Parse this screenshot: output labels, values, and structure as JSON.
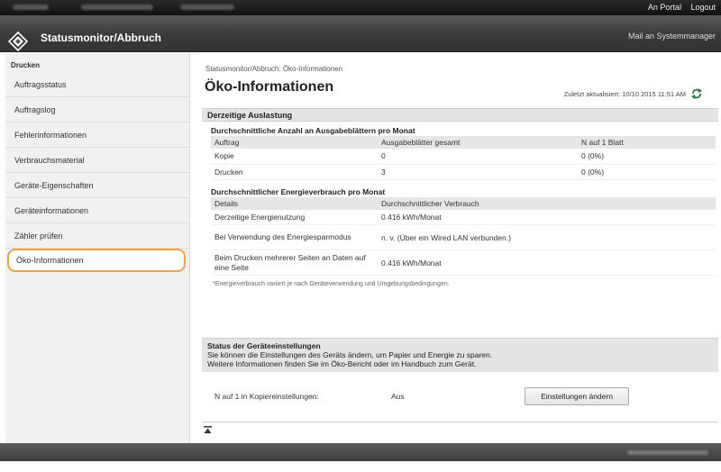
{
  "topbar": {
    "portal_link": "An Portal",
    "logout_link": "Logout"
  },
  "header": {
    "app_title": "Statusmonitor/Abbruch",
    "mail_link": "Mail an Systemmanager"
  },
  "sidebar": {
    "section_label": "Drucken",
    "items": [
      {
        "label": "Auftragsstatus"
      },
      {
        "label": "Auftragslog"
      },
      {
        "label": "Fehlerinformationen"
      },
      {
        "label": "Verbrauchsmaterial"
      },
      {
        "label": "Geräte-Eigenschaften"
      },
      {
        "label": "Geräteinformationen"
      },
      {
        "label": "Zähler prüfen"
      },
      {
        "label": "Öko-Informationen"
      }
    ],
    "active_index": 7
  },
  "main": {
    "breadcrumb": "Statusmonitor/Abbruch: Öko-Informationen",
    "title": "Öko-Informationen",
    "last_updated": "Zuletzt aktualisiert: 10/10 2015 11:51 AM",
    "usage_panel": {
      "header": "Derzeitige Auslastung",
      "pages_title": "Durchschnittliche Anzahl an Ausgabeblättern pro Monat",
      "pages_columns": [
        "Auftrag",
        "Ausgabeblätter gesamt",
        "N auf 1 Blatt"
      ],
      "pages_rows": [
        [
          "Kopie",
          "0",
          "0 (0%)"
        ],
        [
          "Drucken",
          "3",
          "0 (0%)"
        ]
      ],
      "energy_title": "Durchschnittlicher Energieverbrauch pro Monat",
      "energy_columns": [
        "Details",
        "Durchschnittlicher Verbrauch"
      ],
      "energy_rows": [
        [
          "Derzeitige Energienutzung",
          "0.416  kWh/Monat"
        ],
        [
          "Bei Verwendung des Energiesparmodus",
          "n. v. (Über ein Wired LAN verbunden.)"
        ],
        [
          "Beim Drucken mehrerer Seiten an Daten auf eine Seite",
          "0.416  kWh/Monat"
        ]
      ],
      "note": "*Energieverbrauch variiert je nach Geräteverwendung und Umgebungsbedingungen."
    },
    "status_panel": {
      "header": "Status der Geräteeinstellungen",
      "line1": "Sie können die Einstellungen des Geräts ändern, um Papier und Energie zu sparen.",
      "line2": "Weitere Informationen finden Sie im Öko-Bericht oder im Handbuch zum Gerät.",
      "setting_label": "N auf 1 in Kopiereinstellungen:",
      "setting_value": "Aus",
      "change_button": "Einstellungen ändern"
    },
    "top_icon": "scroll-to-top-icon"
  },
  "colors": {
    "active_border": "#f2a33a",
    "header_bg": "#3a3a3a",
    "panel_header_bg": "#e4e4e4"
  }
}
